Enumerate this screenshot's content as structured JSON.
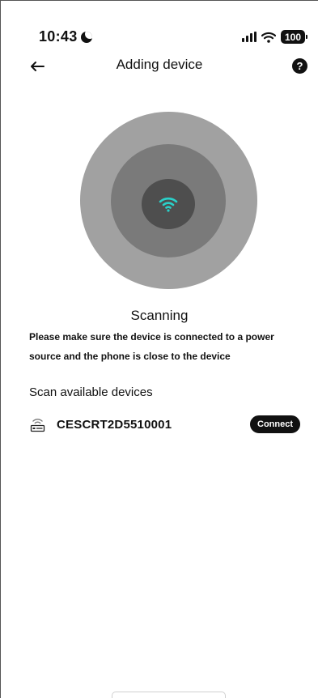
{
  "status_bar": {
    "time": "10:43",
    "battery": "100",
    "icons": [
      "moon-icon",
      "cellular-signal-icon",
      "wifi-icon",
      "battery-icon"
    ]
  },
  "nav": {
    "title": "Adding device",
    "back_icon": "back-arrow-icon",
    "help_icon": "help-icon",
    "help_glyph": "?"
  },
  "scan": {
    "icon": "wifi-icon",
    "accent_color": "#2ad1c9",
    "title": "Scanning",
    "hint": "Please make sure the device is connected to a power source and the phone is close to the device"
  },
  "devices": {
    "section_title": "Scan available devices",
    "items": [
      {
        "icon": "router-icon",
        "name": "CESCRT2D5510001",
        "action_label": "Connect"
      }
    ]
  }
}
